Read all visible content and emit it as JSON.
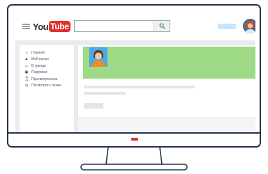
{
  "logo": {
    "you": "You",
    "tube": "Tube"
  },
  "search": {
    "icon": "search-icon"
  },
  "sidebar": {
    "items": [
      {
        "label": "Главная",
        "icon": "home-icon"
      },
      {
        "label": "Мой канал",
        "icon": "user-icon"
      },
      {
        "label": "В тренде",
        "icon": "flame-icon"
      },
      {
        "label": "Подписки",
        "icon": "subscriptions-icon"
      },
      {
        "label": "Просмотренные",
        "icon": "hourglass-icon"
      },
      {
        "label": "Посмотреть позже",
        "icon": "clock-icon"
      }
    ]
  },
  "colors": {
    "cover": "#9fda86",
    "brand_red": "#e0312e",
    "frame": "#23324a",
    "screen_bg": "#e9ebee"
  }
}
